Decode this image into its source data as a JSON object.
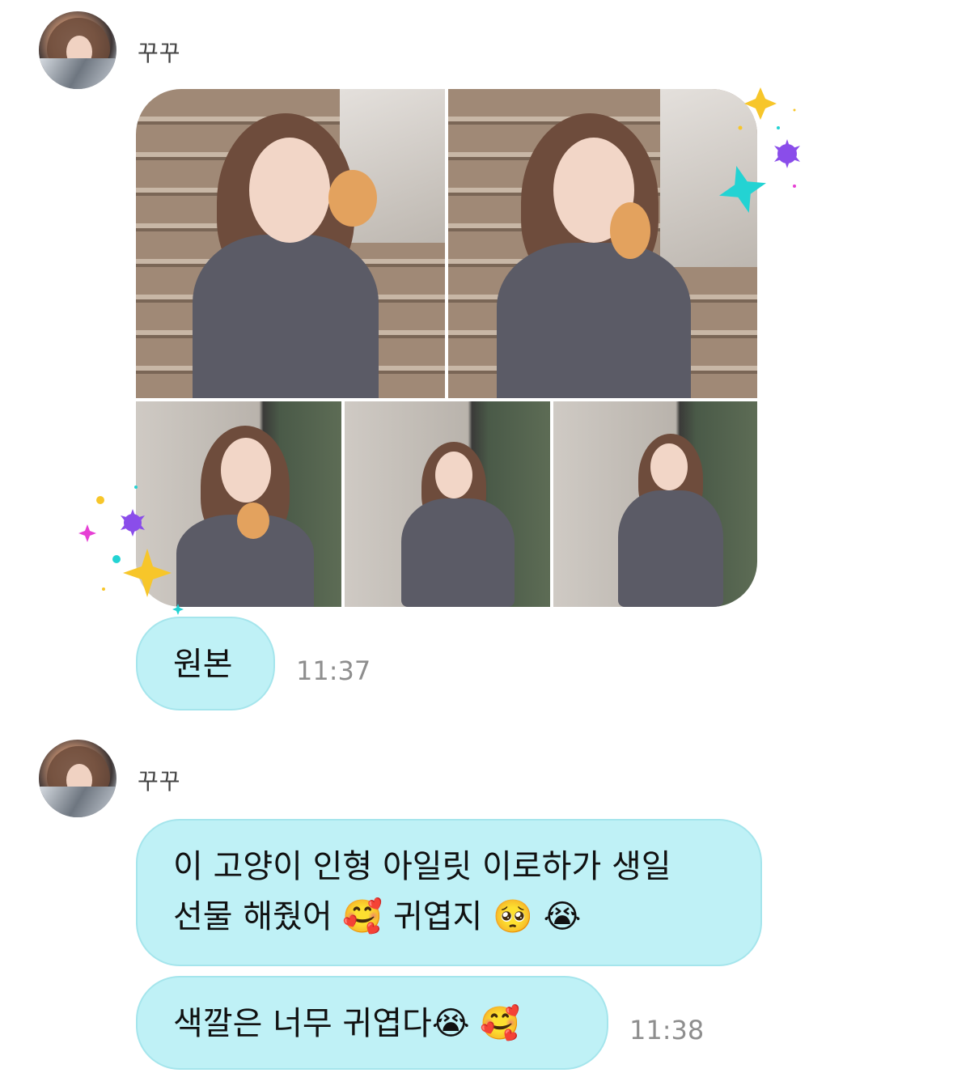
{
  "messages": [
    {
      "sender": "꾸꾸",
      "photo_count": 5,
      "bubble_text": "원본",
      "time": "11:37"
    },
    {
      "sender": "꾸꾸",
      "bubble_line1": "이 고양이 인형 아일릿 이로하가 생일",
      "bubble_line2_text": "선물 해줬어 🥰 귀엽지 🥺 😭",
      "bubble2_text": "색깔은 너무 귀엽다😭 🥰",
      "time": "11:38"
    }
  ],
  "colors": {
    "bubble_bg": "#bff1f6",
    "bubble_border": "#a5e5ec",
    "time_text": "#8e8e8e",
    "sparkle_yellow": "#f7c62a",
    "sparkle_cyan": "#23d3d3",
    "sparkle_purple": "#8a4dea",
    "sparkle_pink": "#e63fd4"
  }
}
